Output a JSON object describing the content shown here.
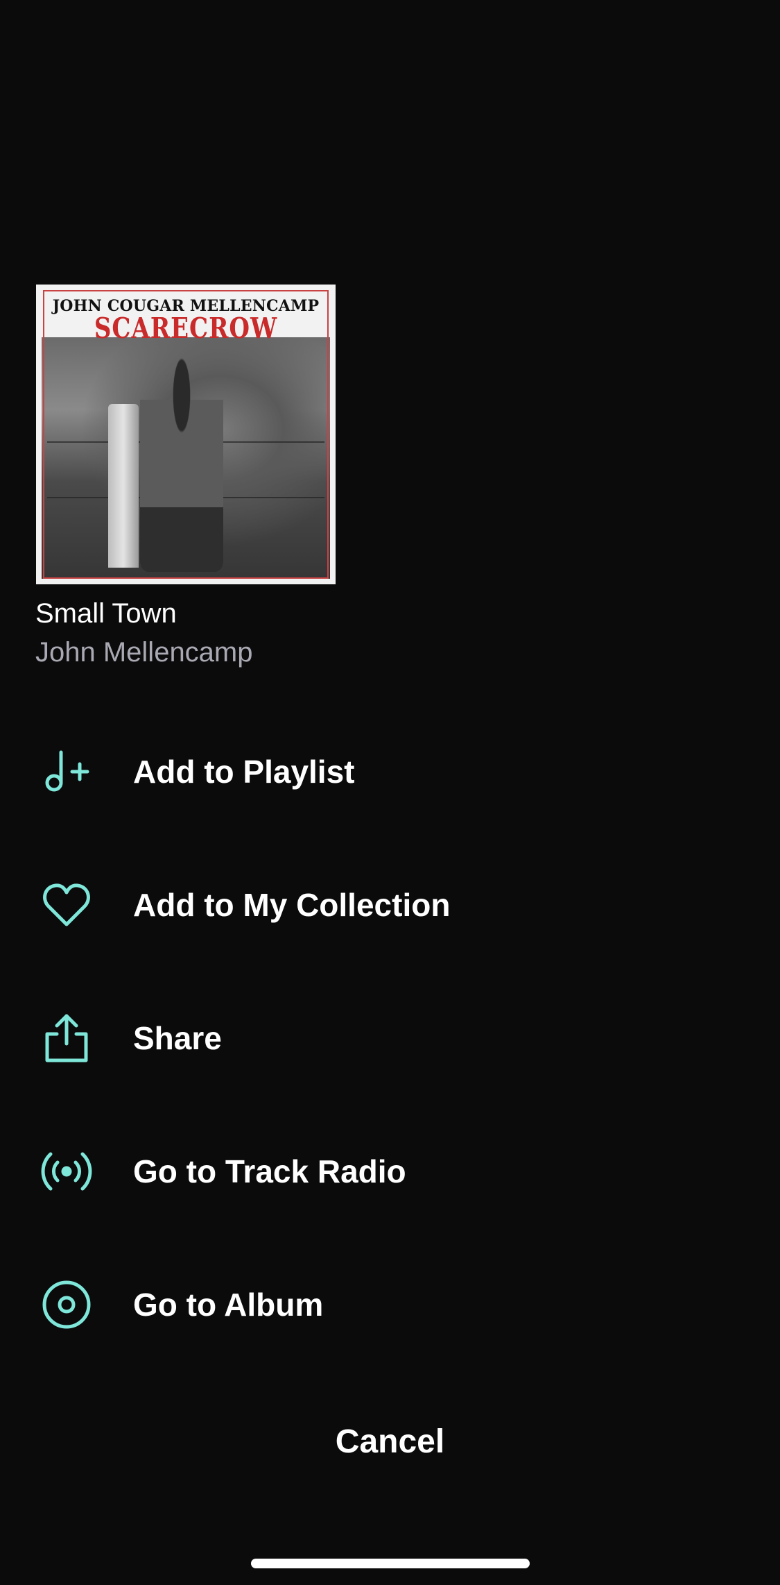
{
  "track": {
    "title": "Small Town",
    "artist": "John Mellencamp",
    "artwork": {
      "artist_text": "JOHN COUGAR MELLENCAMP",
      "album_text": "SCARECROW"
    }
  },
  "menu": {
    "items": [
      {
        "label": "Add to Playlist",
        "icon": "music-note-plus-icon"
      },
      {
        "label": "Add to My Collection",
        "icon": "heart-icon"
      },
      {
        "label": "Share",
        "icon": "share-icon"
      },
      {
        "label": "Go to Track Radio",
        "icon": "radio-broadcast-icon"
      },
      {
        "label": "Go to Album",
        "icon": "album-disc-icon"
      }
    ]
  },
  "cancel_label": "Cancel",
  "colors": {
    "background": "#0b0b0b",
    "accent": "#7fe6da",
    "secondary_text": "#a9a9b3"
  }
}
